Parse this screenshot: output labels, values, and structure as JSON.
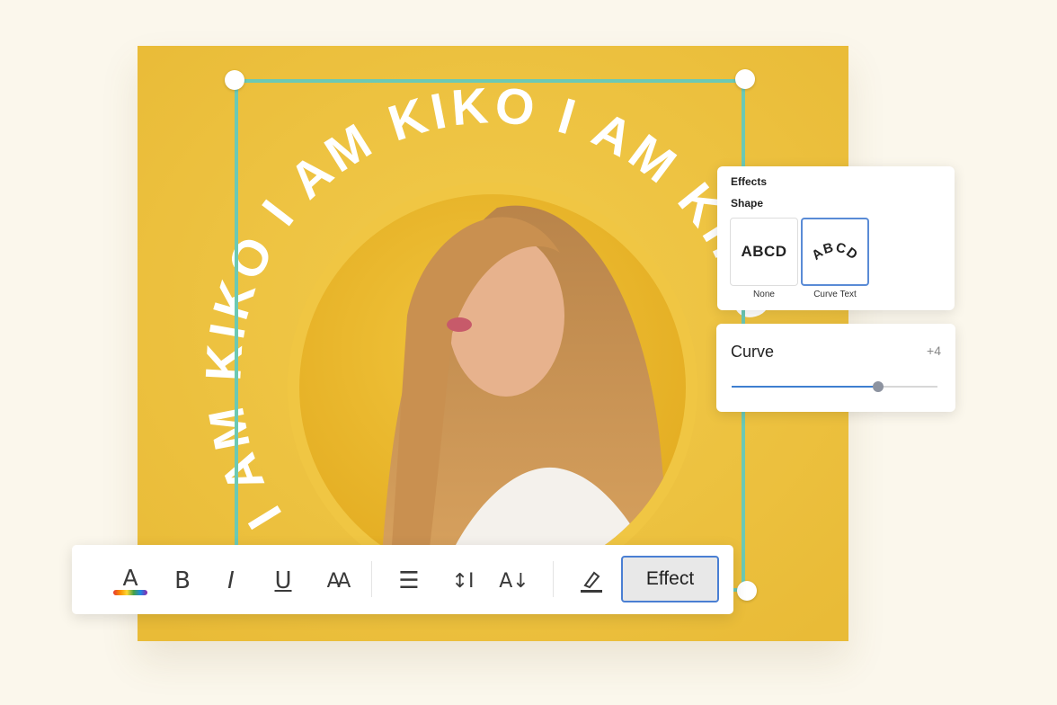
{
  "canvas": {
    "curved_text": "I AM KIKO I AM KIKO I AM KIKO",
    "background_color": "#edc03d",
    "selection_color": "#6cc9b4"
  },
  "effects_panel": {
    "title": "Effects",
    "shape_label": "Shape",
    "options": [
      {
        "sample": "ABCD",
        "caption": "None"
      },
      {
        "sample": "ABCD",
        "caption": "Curve Text",
        "selected": true
      }
    ]
  },
  "curve_panel": {
    "label": "Curve",
    "value": "+4",
    "slider_level": 0.71
  },
  "toolbar": {
    "icons": [
      "text-color-icon",
      "bold-icon",
      "italic-icon",
      "underline-icon",
      "font-size-icon",
      "align-icon",
      "line-spacing-icon",
      "letter-spacing-icon",
      "highlight-icon"
    ],
    "effect_label": "Effect",
    "accent": "#4a7fd3"
  }
}
